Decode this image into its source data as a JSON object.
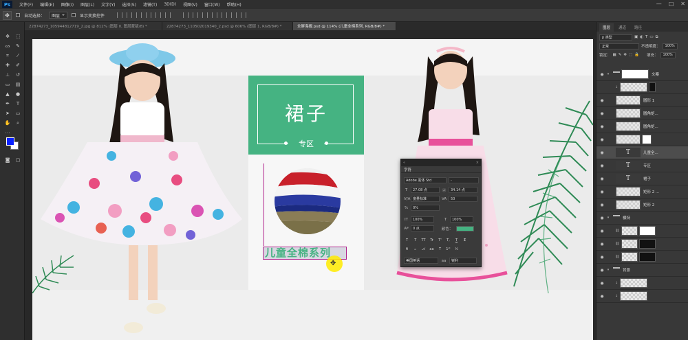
{
  "app": {
    "logo": "Ps",
    "menu": [
      "文件(F)",
      "编辑(E)",
      "图像(I)",
      "图层(L)",
      "文字(Y)",
      "选择(S)",
      "滤镜(T)",
      "3D(D)",
      "视图(V)",
      "窗口(W)",
      "帮助(H)"
    ],
    "window_controls": [
      "—",
      "□",
      "✕"
    ]
  },
  "options_bar": {
    "auto_select_label": "自动选择：",
    "auto_select_value": "图层",
    "show_transform_label": "显示变换控件"
  },
  "tabs": [
    {
      "label": "22874273_105944812719_2.jpg @ 812% (图层 0, 图层蒙版/8) *",
      "active": false
    },
    {
      "label": "22874273_110502019340_2.psd @ 606% (图层 1, RGB/8#) *",
      "active": false
    },
    {
      "label": "全屏海报.psd @ 114% (儿童全棉系列, RGB/8#) *",
      "active": true
    }
  ],
  "canvas": {
    "title": "裙子",
    "subtitle": "专区",
    "series_label": "儿童全棉系列",
    "accent_color": "#45b382"
  },
  "character_panel": {
    "tab": "字符",
    "font_family": "Adobe 黑体 Std",
    "font_style": "-",
    "font_size": "27.08 点",
    "leading": "34.14 点",
    "kerning": "度量标准",
    "tracking": "50",
    "scale_pct": "0%",
    "vertical_scale": "100%",
    "horizontal_scale": "100%",
    "baseline_shift": "0 点",
    "color_label": "颜色：",
    "color": "#45b382",
    "style_buttons": [
      "T",
      "T",
      "TT",
      "Tr",
      "T'",
      "T,",
      "T",
      "T"
    ],
    "language": "美国英语",
    "antialias": "锐利"
  },
  "layers_panel": {
    "tabs": [
      "图层",
      "通道",
      "路径"
    ],
    "filter_label": "p 类型",
    "blend_mode": "正常",
    "opacity_label": "不透明度：",
    "opacity": "100%",
    "lock_label": "锁定：",
    "fill_label": "填充：",
    "fill": "100%",
    "layers": [
      {
        "name": "文案",
        "kind": "folder",
        "mask": "white",
        "selected": false
      },
      {
        "name": "",
        "kind": "thumb",
        "mask": "black",
        "selected": false
      },
      {
        "name": "圆形 1",
        "kind": "thumb",
        "mask": "",
        "selected": false
      },
      {
        "name": "圆角矩...",
        "kind": "thumb",
        "mask": "",
        "selected": false
      },
      {
        "name": "圆角矩...",
        "kind": "thumb",
        "mask": "",
        "selected": false
      },
      {
        "name": "",
        "kind": "thumb",
        "mask": "white",
        "selected": false
      },
      {
        "name": "儿童全...",
        "kind": "text",
        "mask": "",
        "selected": true
      },
      {
        "name": "专区",
        "kind": "text",
        "mask": "",
        "selected": false
      },
      {
        "name": "裙子",
        "kind": "text",
        "mask": "",
        "selected": false
      },
      {
        "name": "矩形 2 ...",
        "kind": "thumb",
        "mask": "",
        "selected": false
      },
      {
        "name": "矩形 2",
        "kind": "thumb",
        "mask": "",
        "selected": false
      },
      {
        "name": "模特",
        "kind": "folder",
        "mask": "",
        "selected": false
      },
      {
        "name": "",
        "kind": "thumb",
        "mask": "white",
        "selected": false
      },
      {
        "name": "",
        "kind": "thumb",
        "mask": "black",
        "selected": false
      },
      {
        "name": "",
        "kind": "thumb",
        "mask": "black",
        "selected": false
      },
      {
        "name": "背景",
        "kind": "folder",
        "mask": "",
        "selected": false
      },
      {
        "name": "",
        "kind": "thumb",
        "mask": "",
        "selected": false
      },
      {
        "name": "",
        "kind": "thumb",
        "mask": "",
        "selected": false
      },
      {
        "name": "",
        "kind": "thumb",
        "mask": "",
        "selected": false
      }
    ]
  }
}
